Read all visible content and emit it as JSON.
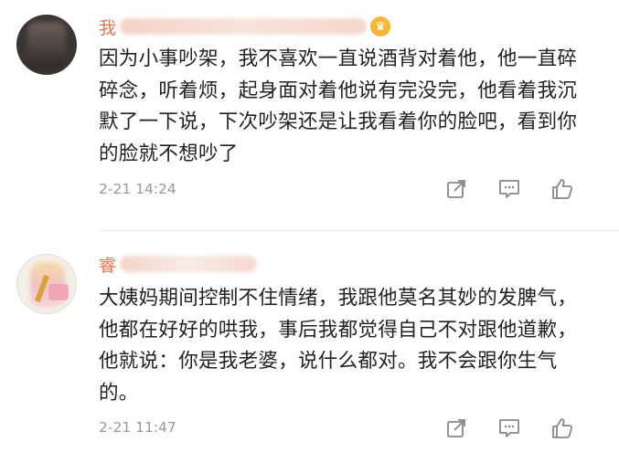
{
  "comments": [
    {
      "username": "我",
      "text": "因为小事吵架，我不喜欢一直说酒背对着他，他一直碎碎念，听着烦，起身面对着他说有完没完，他看着我沉默了一下说，下次吵架还是让我看着你的脸吧，看到你的脸就不想吵了",
      "time": "2-21 14:24",
      "has_crown": true
    },
    {
      "username": "睿",
      "text": "大姨妈期间控制不住情绪，我跟他莫名其妙的发脾气，他都在好好的哄我，事后我都觉得自己不对跟他道歉，他就说：你是我老婆，说什么都对。我不会跟你生气的。",
      "time": "2-21 11:47",
      "has_crown": false
    }
  ],
  "icons": {
    "repost": "repost-icon",
    "comment": "comment-icon",
    "like": "like-icon"
  },
  "colors": {
    "username": "#eb7350",
    "text": "#222222",
    "time": "#999999",
    "crown": "#f7b733"
  }
}
